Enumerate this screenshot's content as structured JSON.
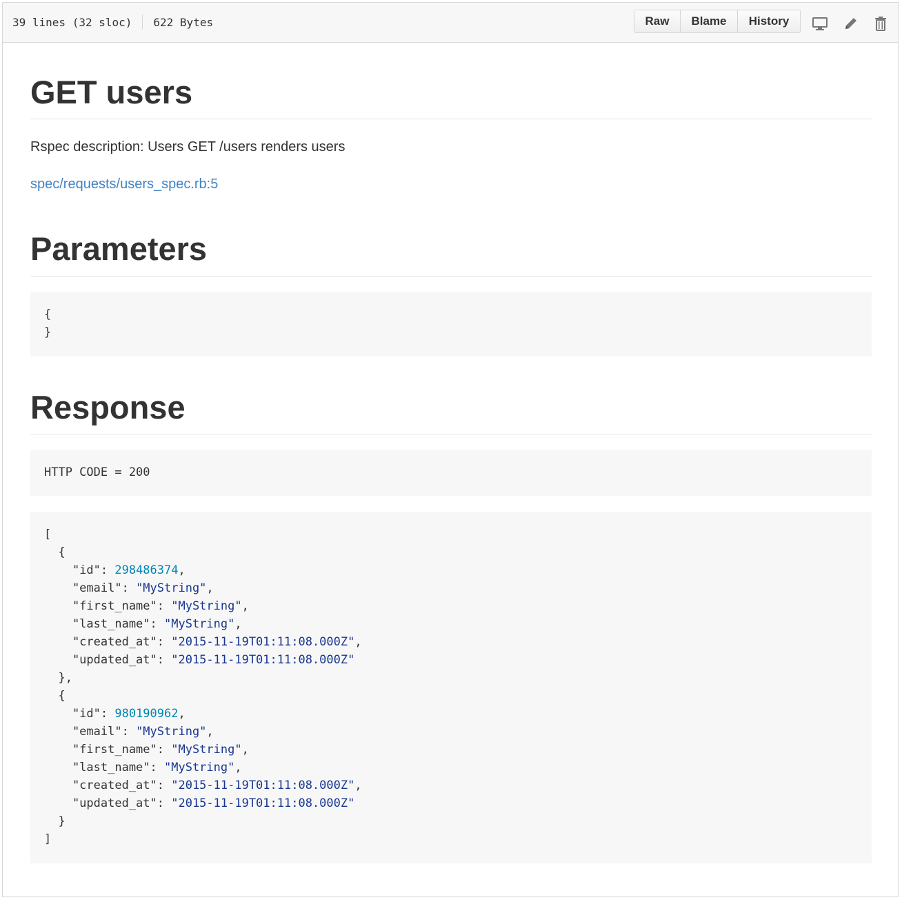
{
  "header": {
    "lines": "39 lines (32 sloc)",
    "size": "622 Bytes",
    "buttons": {
      "raw": "Raw",
      "blame": "Blame",
      "history": "History"
    }
  },
  "content": {
    "title": "GET users",
    "description": "Rspec description: Users GET /users renders users",
    "spec_link": "spec/requests/users_spec.rb:5",
    "parameters_heading": "Parameters",
    "parameters_open": "{",
    "parameters_close": "}",
    "response_heading": "Response",
    "http_code": "HTTP CODE = 200",
    "users": [
      {
        "id": "298486374",
        "email": "\"MyString\"",
        "first_name": "\"MyString\"",
        "last_name": "\"MyString\"",
        "created_at": "\"2015-11-19T01:11:08.000Z\"",
        "updated_at": "\"2015-11-19T01:11:08.000Z\""
      },
      {
        "id": "980190962",
        "email": "\"MyString\"",
        "first_name": "\"MyString\"",
        "last_name": "\"MyString\"",
        "created_at": "\"2015-11-19T01:11:08.000Z\"",
        "updated_at": "\"2015-11-19T01:11:08.000Z\""
      }
    ]
  },
  "icons": [
    "desktop-icon",
    "pencil-icon",
    "trash-icon"
  ],
  "colors": {
    "link": "#4183c4",
    "number": "#0086b3",
    "string": "#183691"
  }
}
